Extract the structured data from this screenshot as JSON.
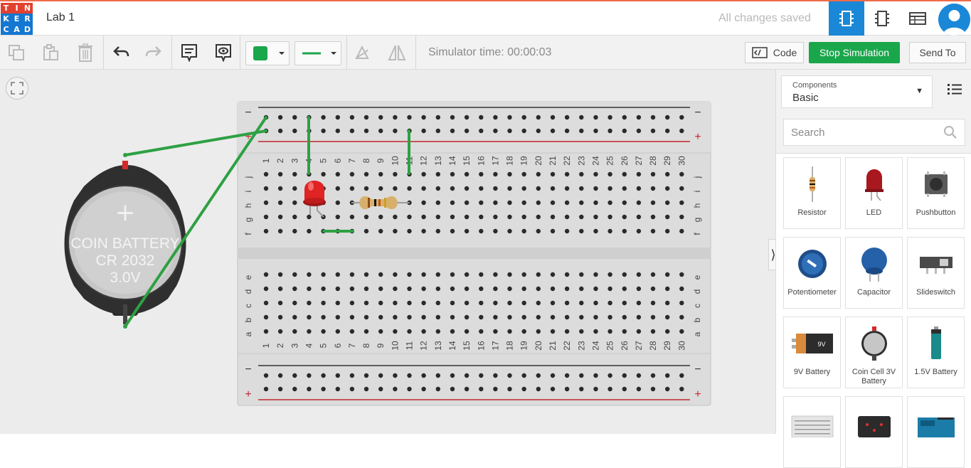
{
  "header": {
    "logo_letters": [
      "T",
      "I",
      "N",
      "K",
      "E",
      "R",
      "C",
      "A",
      "D"
    ],
    "logo_colors": [
      "#e2412f",
      "#e2412f",
      "#e2412f",
      "#1477d1",
      "#1477d1",
      "#1477d1",
      "#1477d1",
      "#1477d1",
      "#1477d1"
    ],
    "project_name": "Lab 1",
    "save_status": "All changes saved",
    "views": [
      {
        "icon": "circuit-view-icon",
        "active": true
      },
      {
        "icon": "schematic-view-icon",
        "active": false
      },
      {
        "icon": "component-list-icon",
        "active": false
      }
    ],
    "avatar_icon": "user-avatar-icon"
  },
  "toolbar": {
    "simulator_time_label": "Simulator time: 00:00:03",
    "code_label": "Code",
    "stop_label": "Stop Simulation",
    "send_label": "Send To",
    "wire_color": "#1aa64b",
    "icons": [
      "copy-icon",
      "paste-icon",
      "delete-icon",
      "undo-icon",
      "redo-icon",
      "notes-icon",
      "notes-visibility-icon",
      "wire-color-icon",
      "wire-type-icon",
      "rotate-icon",
      "flip-icon"
    ]
  },
  "canvas": {
    "breadboard": {
      "columns": [
        "1",
        "2",
        "3",
        "4",
        "5",
        "6",
        "7",
        "8",
        "9",
        "10",
        "11",
        "12",
        "13",
        "14",
        "15",
        "16",
        "17",
        "18",
        "19",
        "20",
        "21",
        "22",
        "23",
        "24",
        "25",
        "26",
        "27",
        "28",
        "29",
        "30"
      ],
      "top_rows": [
        "j",
        "i",
        "h",
        "g",
        "f"
      ],
      "bottom_rows": [
        "e",
        "d",
        "c",
        "b",
        "a"
      ],
      "rail_minus": "−",
      "rail_plus": "+"
    },
    "battery": {
      "line1": "COIN BATTERY",
      "line2": "CR 2032",
      "line3": "3.0V",
      "plus_symbol": "+"
    }
  },
  "panel": {
    "components_label": "Components",
    "components_value": "Basic",
    "search_placeholder": "Search",
    "items": [
      {
        "label": "Resistor",
        "icon": "resistor-icon"
      },
      {
        "label": "LED",
        "icon": "led-icon"
      },
      {
        "label": "Pushbutton",
        "icon": "pushbutton-icon"
      },
      {
        "label": "Potentiometer",
        "icon": "potentiometer-icon"
      },
      {
        "label": "Capacitor",
        "icon": "capacitor-icon"
      },
      {
        "label": "Slideswitch",
        "icon": "slideswitch-icon"
      },
      {
        "label": "9V Battery",
        "icon": "9v-battery-icon"
      },
      {
        "label": "Coin Cell 3V Battery",
        "icon": "coin-cell-battery-icon"
      },
      {
        "label": "1.5V Battery",
        "icon": "aa-battery-icon"
      },
      {
        "label": "",
        "icon": "breadboard-icon"
      },
      {
        "label": "",
        "icon": "microbit-icon"
      },
      {
        "label": "",
        "icon": "arduino-icon"
      }
    ],
    "battery_label_9v": "9V"
  }
}
